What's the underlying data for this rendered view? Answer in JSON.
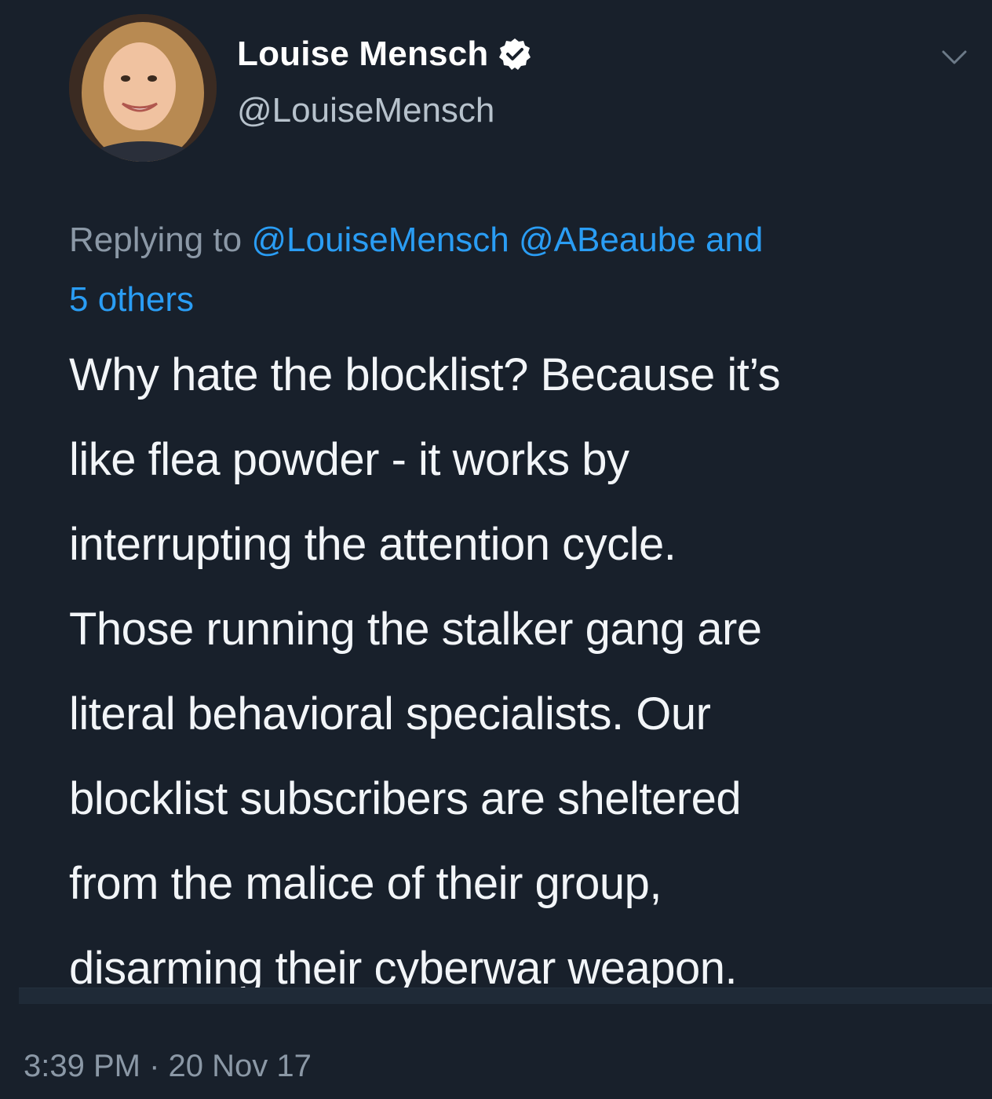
{
  "tweet": {
    "display_name": "Louise Mensch",
    "handle": "@LouiseMensch",
    "verified": true,
    "reply": {
      "prefix": "Replying to",
      "mentions": [
        "@LouiseMensch",
        "@ABeaube"
      ],
      "and_text": "and",
      "others": "5 others"
    },
    "body": "Why hate the blocklist?  Because it’s\nlike flea powder  - it works by\ninterrupting the attention cycle.\nThose running the stalker gang are\nliteral behavioral specialists. Our\nblocklist subscribers are sheltered\nfrom the malice of their group,\ndisarming their cyberwar weapon.",
    "timestamp": "3:39 PM · 20 Nov 17"
  },
  "icons": {
    "verified": "verified-badge-icon",
    "menu": "chevron-down-icon",
    "avatar": "profile-photo"
  },
  "colors": {
    "background": "#18202b",
    "link": "#2a9df4",
    "secondary_text": "#8b98a6"
  }
}
